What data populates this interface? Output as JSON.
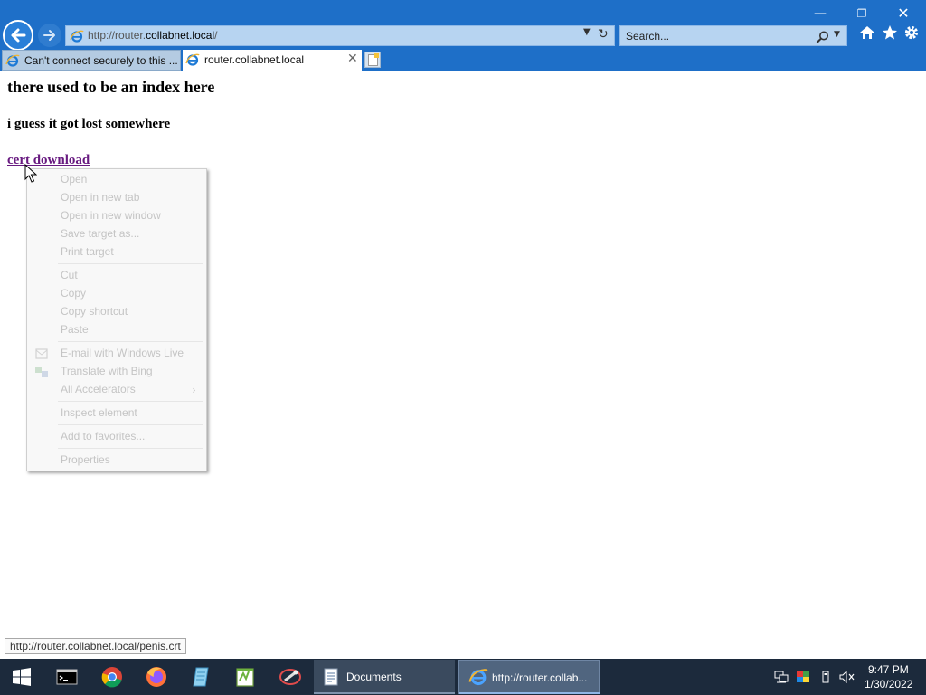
{
  "window": {
    "minimize_glyph": "—",
    "maximize_glyph": "❐",
    "close_glyph": "✕"
  },
  "nav": {
    "back_icon": "back-arrow-icon",
    "forward_icon": "forward-arrow-icon"
  },
  "address": {
    "scheme": "http://",
    "sub": "router.",
    "host": "collabnet.local",
    "path": "/"
  },
  "search": {
    "placeholder": "Search..."
  },
  "toolbar": {
    "home_icon": "home-icon",
    "favorites_icon": "star-icon",
    "tools_icon": "gear-icon"
  },
  "tabs": [
    {
      "label": "Can't connect securely to this ...",
      "active": false
    },
    {
      "label": "router.collabnet.local",
      "active": true
    }
  ],
  "page": {
    "heading": "there used to be an index here",
    "subheading": "i guess it got lost somewhere",
    "link_text": "cert download"
  },
  "context_menu": {
    "items": [
      "Open",
      "Open in new tab",
      "Open in new window",
      "Save target as...",
      "Print target",
      "Cut",
      "Copy",
      "Copy shortcut",
      "Paste",
      "E-mail with Windows Live",
      "Translate with Bing",
      "All Accelerators",
      "Inspect element",
      "Add to favorites...",
      "Properties"
    ]
  },
  "status_url": "http://router.collabnet.local/penis.crt",
  "taskbar": {
    "tasks": [
      {
        "label": "Documents"
      },
      {
        "label": "http://router.collab..."
      }
    ],
    "pinned": [
      "command-prompt-icon",
      "chrome-icon",
      "firefox-icon",
      "notepad-icon",
      "notepad-plus-icon",
      "tool-icon"
    ],
    "clock_time": "9:47 PM",
    "clock_date": "1/30/2022"
  },
  "colors": {
    "chrome_bg": "#1e6fc8",
    "link_visited": "#681a80",
    "taskbar_bg": "#1c2a3c"
  }
}
